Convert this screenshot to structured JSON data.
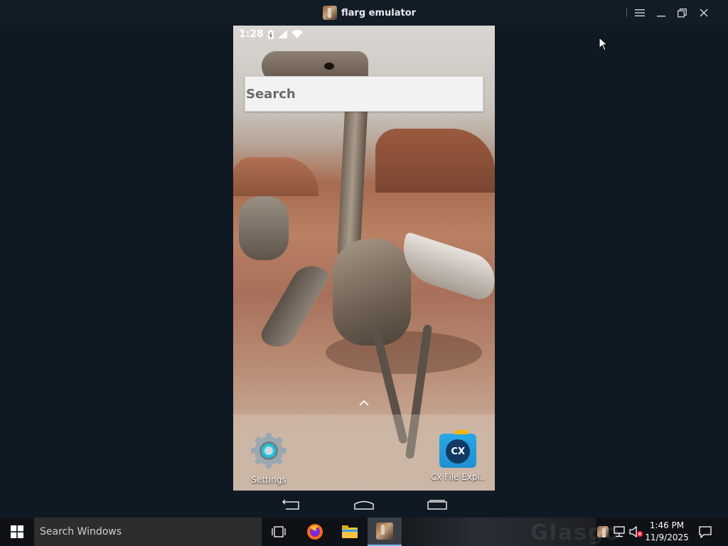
{
  "window": {
    "title": "flarg emulator"
  },
  "android": {
    "status_time": "1:28",
    "search_placeholder": "Search",
    "dock": [
      {
        "label": "Settings",
        "icon": "settings-gear-icon"
      },
      {
        "label": "Cx File Expl..",
        "icon": "cx-file-explorer-icon"
      }
    ]
  },
  "taskbar": {
    "search_placeholder": "Search Windows",
    "clock_time": "1:46 PM",
    "clock_date": "11/9/2025",
    "wallpaper_text": "Glasgo"
  },
  "colors": {
    "taskbar_bg": "#0e1116",
    "titlebar_bg": "#121c26",
    "active_indicator": "#76b9ed"
  }
}
